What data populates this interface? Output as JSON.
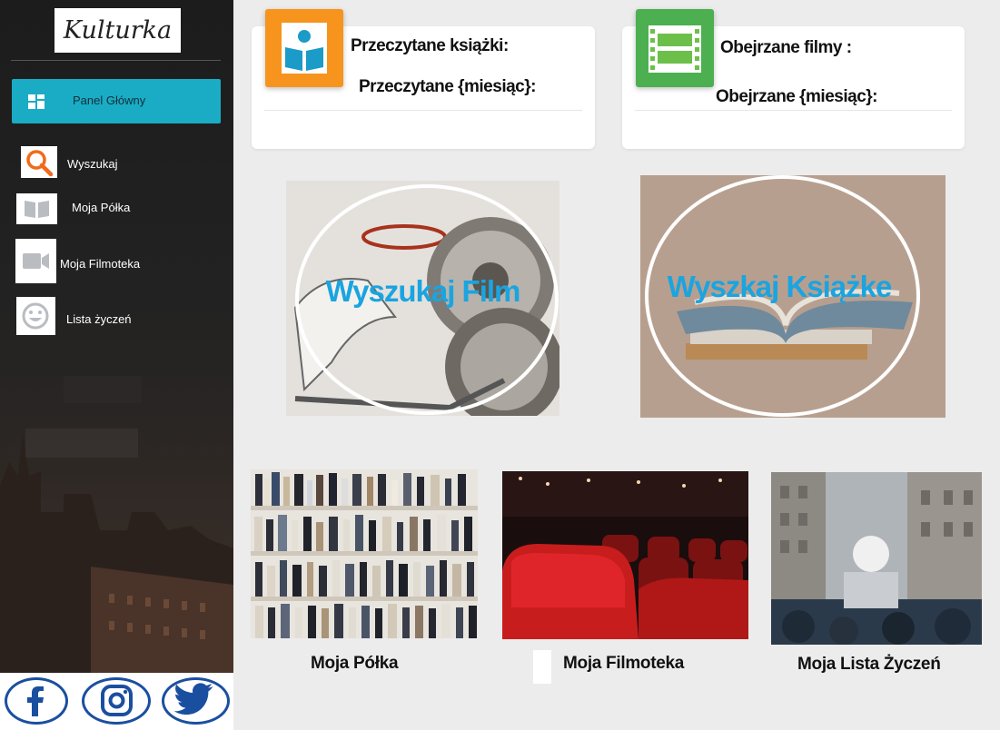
{
  "app": {
    "logo_text": "Kulturka"
  },
  "sidebar": {
    "active_item": {
      "label": "Panel Główny",
      "icon": "dashboard-grid-icon"
    },
    "items": [
      {
        "label": "Wyszukaj",
        "icon": "search-icon"
      },
      {
        "label": "Moja Półka",
        "icon": "book-icon"
      },
      {
        "label": "Moja Filmoteka",
        "icon": "video-camera-icon"
      },
      {
        "label": "Lista życzeń",
        "icon": "smiley-icon"
      }
    ],
    "social": [
      {
        "name": "facebook",
        "icon": "facebook-icon"
      },
      {
        "name": "instagram",
        "icon": "instagram-icon"
      },
      {
        "name": "twitter",
        "icon": "twitter-icon"
      }
    ]
  },
  "stats": {
    "books": {
      "title": "Przeczytane książki:",
      "subtitle": "Przeczytane {miesiąc}:",
      "icon": "reader-book-icon",
      "color": "#f7941d"
    },
    "movies": {
      "title": "Obejrzane filmy :",
      "subtitle": "Obejrzane {miesiąc}:",
      "icon": "film-strip-icon",
      "color": "#4caf50"
    }
  },
  "features": {
    "film": {
      "label": "Wyszukaj Film"
    },
    "book": {
      "label": "Wyszkaj Książke"
    }
  },
  "tiles": [
    {
      "label": "Moja Półka"
    },
    {
      "label": "Moja Filmoteka"
    },
    {
      "label": "Moja Lista Życzeń"
    }
  ],
  "colors": {
    "accent": "#1aacc5",
    "feature_text": "#1aa4e0"
  }
}
